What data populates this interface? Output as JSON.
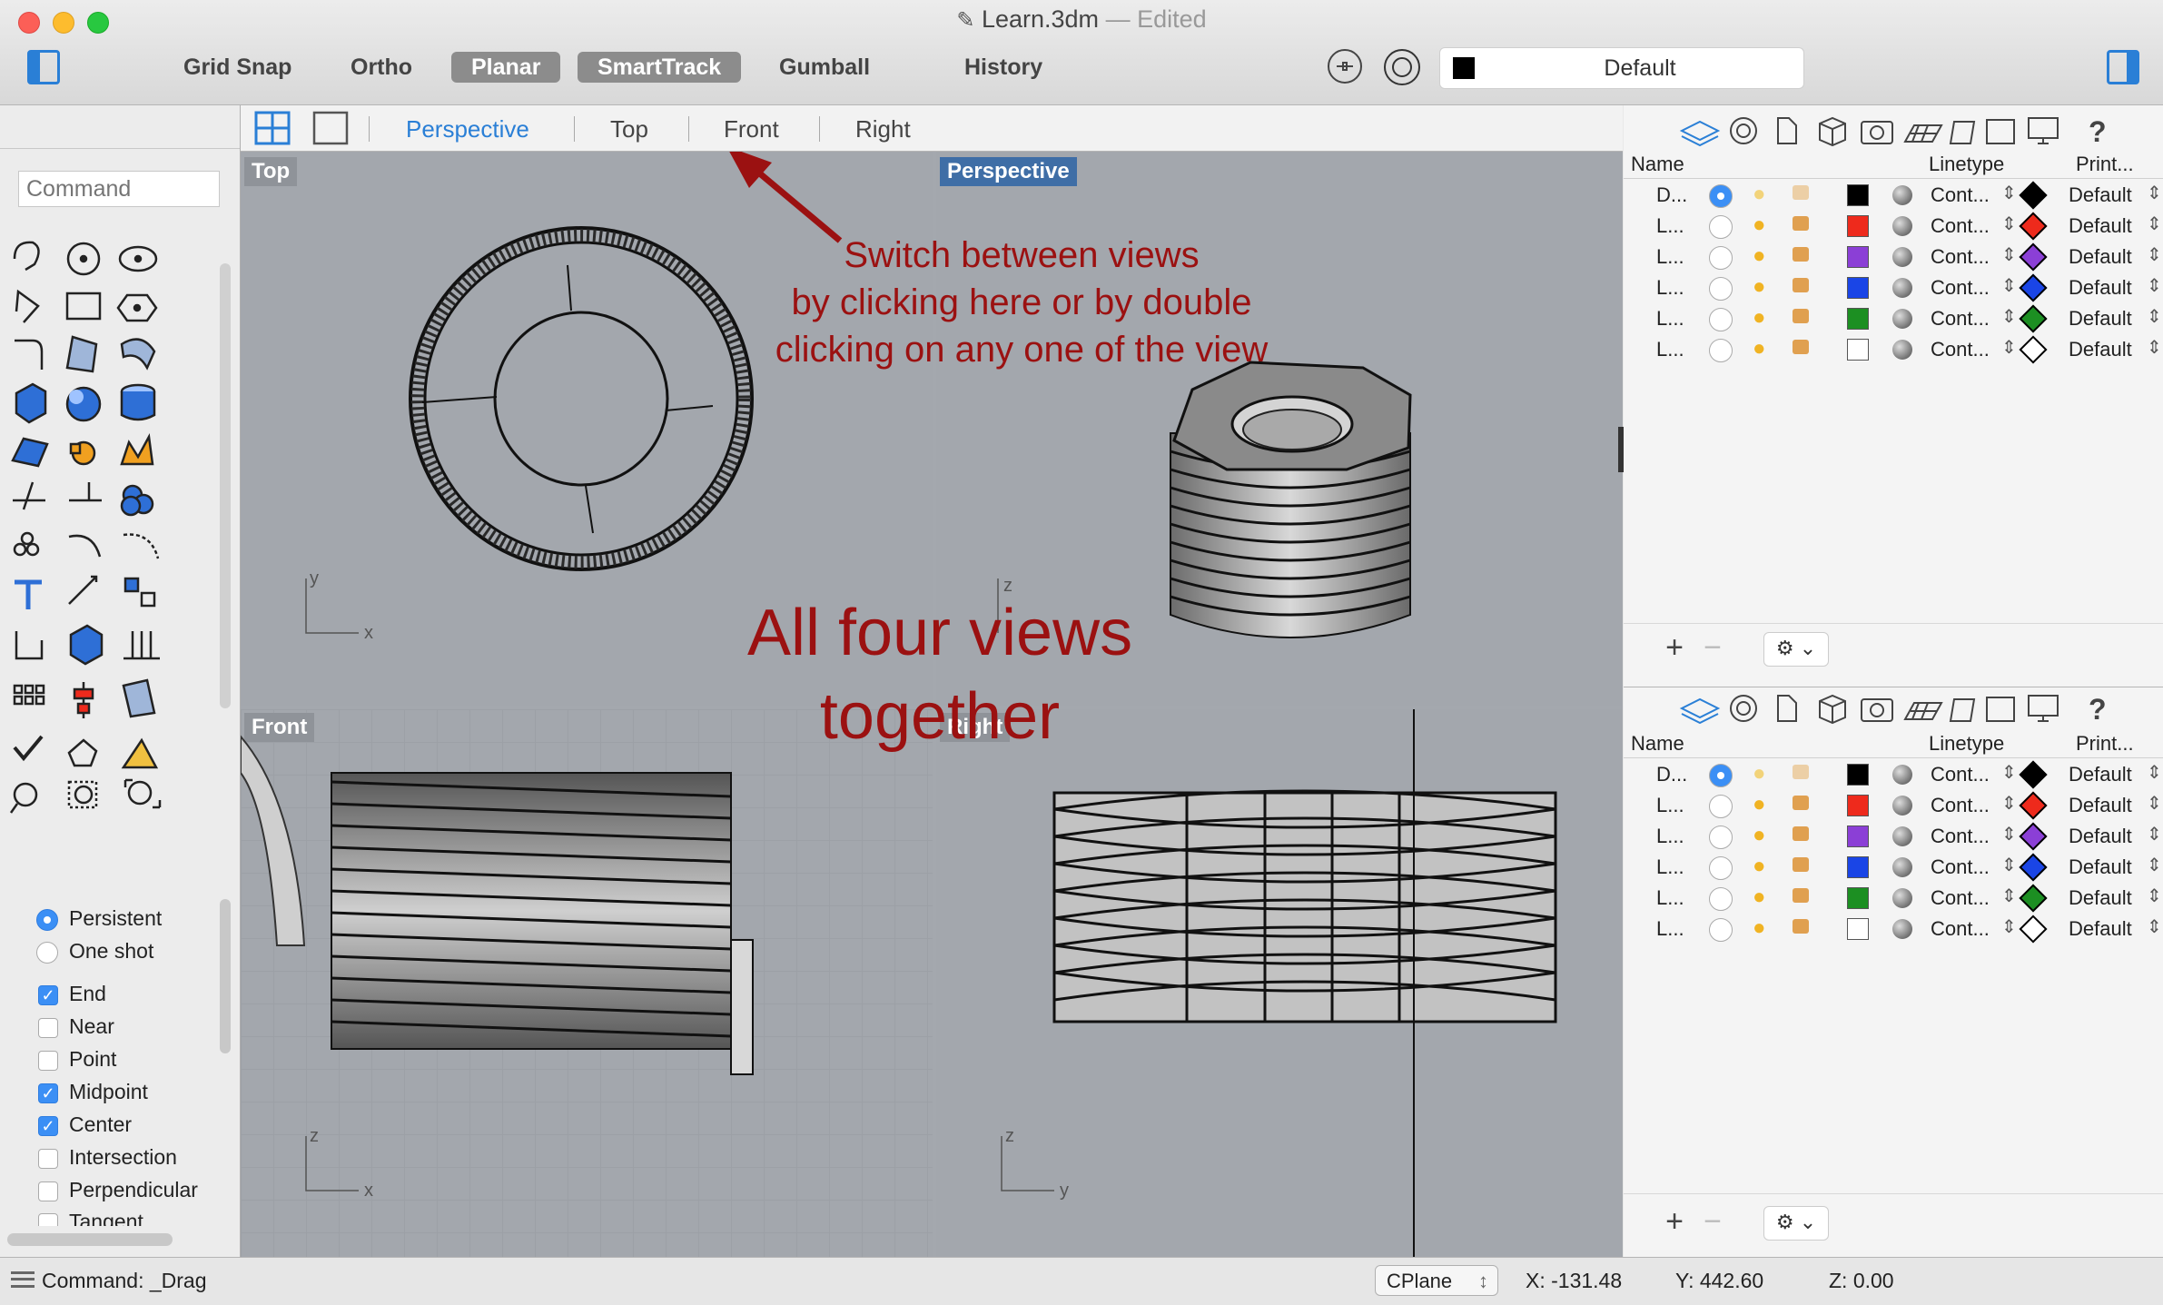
{
  "window": {
    "title": "Learn.3dm",
    "title_sep": "—",
    "status": "Edited"
  },
  "toolbar": {
    "buttons": [
      {
        "label": "Grid Snap",
        "on": false
      },
      {
        "label": "Ortho",
        "on": false
      },
      {
        "label": "Planar",
        "on": true
      },
      {
        "label": "SmartTrack",
        "on": true
      },
      {
        "label": "Gumball",
        "on": false
      },
      {
        "label": "History",
        "on": false
      }
    ],
    "layer_name": "Default"
  },
  "command": {
    "placeholder": "Command",
    "status": "Command: _Drag"
  },
  "view_tabs": {
    "tabs": [
      "Perspective",
      "Top",
      "Front",
      "Right"
    ],
    "active": "Perspective"
  },
  "viewports": {
    "top_label": "Top",
    "perspective_label": "Perspective",
    "front_label": "Front",
    "right_label": "Right",
    "axis_x": "x",
    "axis_y": "y",
    "axis_z": "z"
  },
  "annotations": {
    "switch_line1": "Switch between views",
    "switch_line2": "by clicking here or by double",
    "switch_line3": "clicking on any one of the view",
    "four_line1": "All four views",
    "four_line2": "together"
  },
  "osnap": {
    "modes": [
      {
        "label": "Persistent",
        "on": true
      },
      {
        "label": "One shot",
        "on": false
      }
    ],
    "items": [
      {
        "label": "End",
        "on": true
      },
      {
        "label": "Near",
        "on": false
      },
      {
        "label": "Point",
        "on": false
      },
      {
        "label": "Midpoint",
        "on": true
      },
      {
        "label": "Center",
        "on": true
      },
      {
        "label": "Intersection",
        "on": false
      },
      {
        "label": "Perpendicular",
        "on": false
      },
      {
        "label": "Tangent",
        "on": false
      }
    ]
  },
  "layers": {
    "headers": {
      "name": "Name",
      "linetype": "Linetype",
      "print": "Print..."
    },
    "rows": [
      {
        "name": "D...",
        "current": true,
        "color": "#000000",
        "linetype": "Cont...",
        "print": "Default"
      },
      {
        "name": "L...",
        "current": false,
        "color": "#ee2a1c",
        "linetype": "Cont...",
        "print": "Default"
      },
      {
        "name": "L...",
        "current": false,
        "color": "#8b3fd6",
        "linetype": "Cont...",
        "print": "Default"
      },
      {
        "name": "L...",
        "current": false,
        "color": "#1a45e6",
        "linetype": "Cont...",
        "print": "Default"
      },
      {
        "name": "L...",
        "current": false,
        "color": "#1c8f22",
        "linetype": "Cont...",
        "print": "Default"
      },
      {
        "name": "L...",
        "current": false,
        "color": "#ffffff",
        "linetype": "Cont...",
        "print": "Default"
      }
    ]
  },
  "statusbar": {
    "cplane": "CPlane",
    "x": "X: -131.48",
    "y": "Y: 442.60",
    "z": "Z: 0.00"
  },
  "colors": {
    "accent": "#2a7fd6",
    "annotation": "#9b1111",
    "viewport_bg": "#a3a7ad",
    "label_active": "#3f6ea6"
  }
}
